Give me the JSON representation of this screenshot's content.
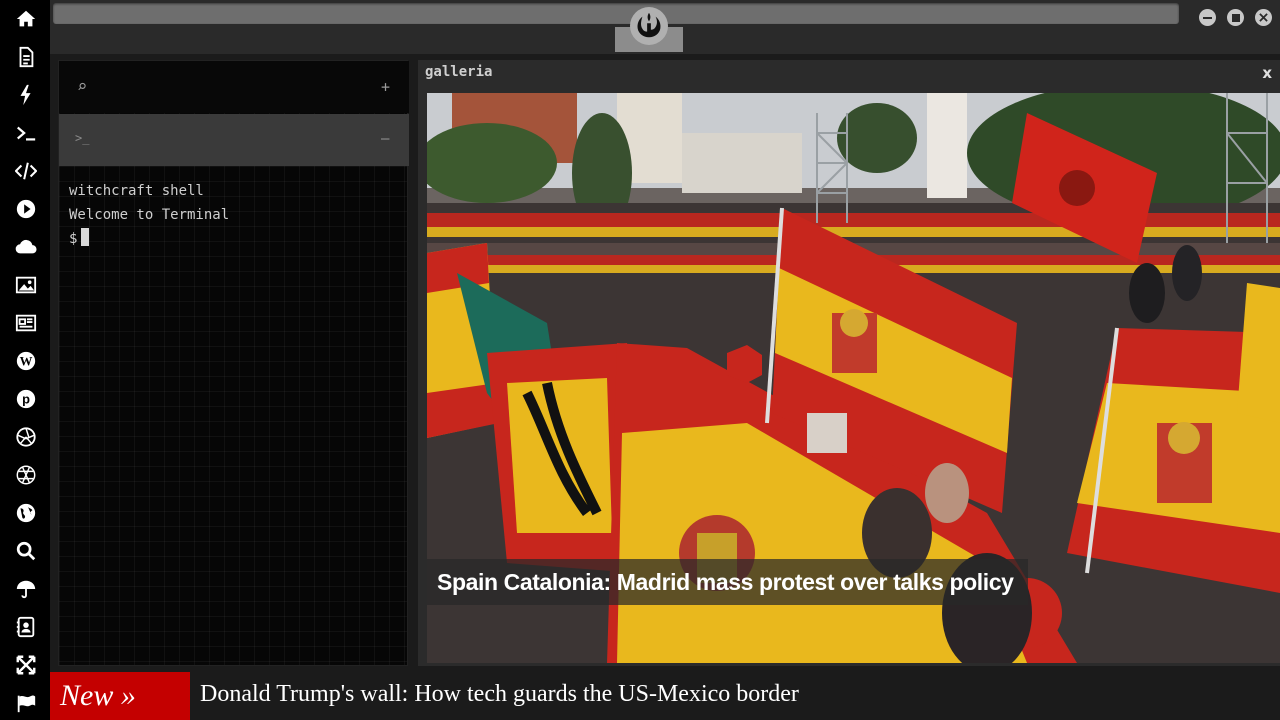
{
  "sidebar": {
    "icons": [
      "home-icon",
      "document-icon",
      "lightning-icon",
      "terminal-icon",
      "code-icon",
      "play-icon",
      "cloud-icon",
      "image-icon",
      "newspaper-icon",
      "wordpress-icon",
      "pinterest-icon",
      "aperture-icon",
      "globe-grid-icon",
      "earth-icon",
      "search-icon",
      "umbrella-icon",
      "contacts-icon",
      "expand-icon",
      "flag-icon"
    ]
  },
  "terminal": {
    "search_icon": "⌕",
    "add_icon": "+",
    "tab_prompt": ">_",
    "tab_collapse": "–",
    "lines": [
      "witchcraft shell",
      "Welcome to Terminal"
    ],
    "prompt": "$"
  },
  "gallery": {
    "title": "galleria",
    "close": "x",
    "caption": "Spain Catalonia: Madrid mass protest over talks policy"
  },
  "ticker": {
    "label": "New »",
    "headline": "Donald Trump's wall: How tech guards the US-Mexico border"
  }
}
